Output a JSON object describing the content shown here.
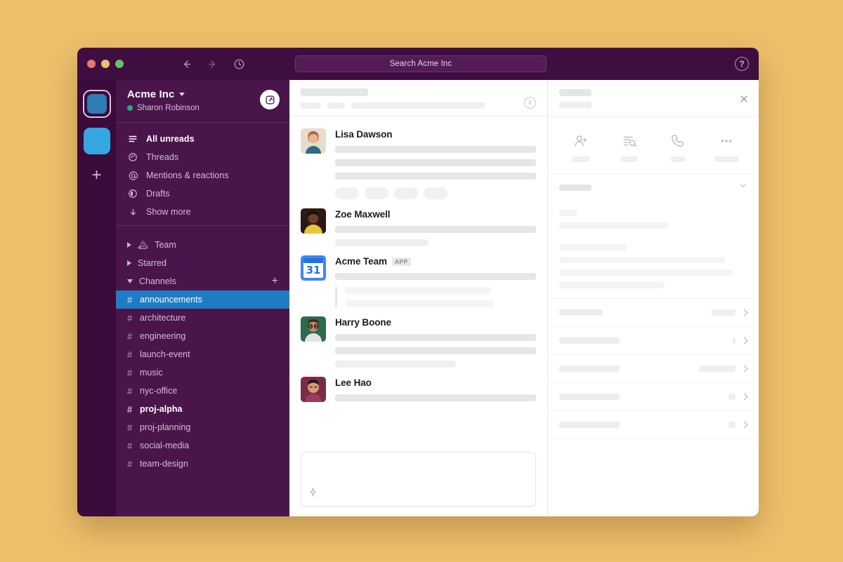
{
  "app": {
    "background_color": "#EDC06C",
    "window_chrome_color": "#3F0E40",
    "sidebar_color": "#4A154B",
    "accent_color": "#1F7CC4"
  },
  "titlebar": {
    "traffic_lights": [
      {
        "name": "close",
        "color": "#E8796B"
      },
      {
        "name": "minimize",
        "color": "#E8C468"
      },
      {
        "name": "zoom",
        "color": "#62C360"
      }
    ],
    "back_icon": "arrow-left-icon",
    "forward_icon": "arrow-right-icon",
    "history_icon": "clock-icon",
    "help_icon": "question-mark-icon",
    "help_label": "?"
  },
  "search": {
    "placeholder": "Search Acme Inc",
    "value": "Search Acme Inc"
  },
  "rail": {
    "workspaces": [
      {
        "name": "workspace-acme",
        "color": "#2C7DB8",
        "selected": true
      },
      {
        "name": "workspace-secondary",
        "color": "#35A7E0",
        "selected": false
      }
    ],
    "add_label": "+"
  },
  "sidebar": {
    "workspace_name": "Acme Inc",
    "workspace_chevron": "chevron-down-icon",
    "user_name": "Sharon Robinson",
    "presence": "active",
    "presence_color": "#2BAC76",
    "compose_icon": "compose-icon",
    "nav": [
      {
        "label": "All unreads",
        "icon": "unreads-icon",
        "bold": true
      },
      {
        "label": "Threads",
        "icon": "threads-icon",
        "bold": false
      },
      {
        "label": "Mentions & reactions",
        "icon": "at-icon",
        "bold": false
      },
      {
        "label": "Drafts",
        "icon": "drafts-icon",
        "bold": false
      },
      {
        "label": "Show more",
        "icon": "arrow-down-icon",
        "bold": false
      }
    ],
    "sections": [
      {
        "label": "Team",
        "emoji": "🏔",
        "expanded": false,
        "has_add": false
      },
      {
        "label": "Starred",
        "emoji": "",
        "expanded": false,
        "has_add": false
      },
      {
        "label": "Channels",
        "emoji": "",
        "expanded": true,
        "has_add": true,
        "add_label": "+"
      }
    ],
    "channels": [
      {
        "label": "announcements",
        "state": "active"
      },
      {
        "label": "architecture",
        "state": "read"
      },
      {
        "label": "engineering",
        "state": "read"
      },
      {
        "label": "launch-event",
        "state": "read"
      },
      {
        "label": "music",
        "state": "read"
      },
      {
        "label": "nyc-office",
        "state": "read"
      },
      {
        "label": "proj-alpha",
        "state": "unread"
      },
      {
        "label": "proj-planning",
        "state": "read"
      },
      {
        "label": "social-media",
        "state": "read"
      },
      {
        "label": "team-design",
        "state": "read"
      }
    ]
  },
  "channel_header": {
    "title_redacted": true,
    "info_icon": "info-icon",
    "info_label": "i"
  },
  "messages": [
    {
      "author": "Lisa Dawson",
      "avatar": "avatar-lisa-dawson",
      "avatar_colors": [
        "#D8B49C",
        "#9E6B4F"
      ],
      "badge": "",
      "body_lines": 3,
      "reactions": 4,
      "quote_lines": 0
    },
    {
      "author": "Zoe Maxwell",
      "avatar": "avatar-zoe-maxwell",
      "avatar_colors": [
        "#4A2F22",
        "#E8C53A"
      ],
      "badge": "",
      "body_lines": 2,
      "reactions": 0,
      "quote_lines": 0
    },
    {
      "author": "Acme Team",
      "avatar": "avatar-acme-team-calendar",
      "avatar_colors": [
        "#3C7BE8",
        "#FFFFFF"
      ],
      "avatar_text": "31",
      "badge": "APP",
      "body_lines": 1,
      "reactions": 0,
      "quote_lines": 2
    },
    {
      "author": "Harry Boone",
      "avatar": "avatar-harry-boone",
      "avatar_colors": [
        "#2F6B4F",
        "#C8916A"
      ],
      "badge": "",
      "body_lines": 3,
      "reactions": 0,
      "quote_lines": 0
    },
    {
      "author": "Lee Hao",
      "avatar": "avatar-lee-hao",
      "avatar_colors": [
        "#7B2B4A",
        "#D09A7E"
      ],
      "badge": "",
      "body_lines": 1,
      "reactions": 0,
      "quote_lines": 0
    }
  ],
  "composer": {
    "placeholder": "",
    "shortcut_icon": "lightning-bolt-icon"
  },
  "panel": {
    "close_icon": "close-icon",
    "actions": [
      {
        "icon": "add-person-icon",
        "label_redacted": true,
        "label_width": 26
      },
      {
        "icon": "file-search-icon",
        "label_redacted": true,
        "label_width": 24
      },
      {
        "icon": "phone-icon",
        "label_redacted": true,
        "label_width": 20
      },
      {
        "icon": "more-horizontal-icon",
        "label_redacted": true,
        "label_width": 34
      }
    ],
    "collapse_icon": "chevron-down-icon",
    "rows": [
      {
        "label_width": 62,
        "value_width": 34,
        "chevron": "chevron-right-icon"
      },
      {
        "label_width": 86,
        "value_width": 4,
        "chevron": "chevron-right-icon"
      },
      {
        "label_width": 86,
        "value_width": 52,
        "chevron": "chevron-right-icon"
      },
      {
        "label_width": 86,
        "value_width": 10,
        "chevron": "chevron-right-icon"
      },
      {
        "label_width": 86,
        "value_width": 10,
        "chevron": "chevron-right-icon"
      }
    ]
  }
}
